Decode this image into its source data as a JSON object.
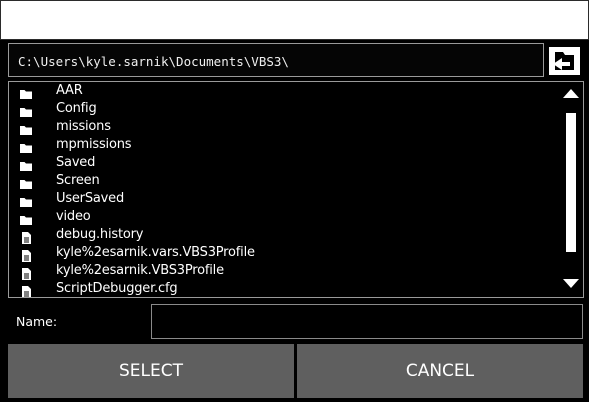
{
  "dialog": {
    "title": "",
    "path": "C:\\Users\\kyle.sarnik\\Documents\\VBS3\\",
    "up_button_icon": "folder-up-arrow-icon",
    "files": [
      {
        "name": "AAR",
        "type": "folder"
      },
      {
        "name": "Config",
        "type": "folder"
      },
      {
        "name": "missions",
        "type": "folder"
      },
      {
        "name": "mpmissions",
        "type": "folder"
      },
      {
        "name": "Saved",
        "type": "folder"
      },
      {
        "name": "Screen",
        "type": "folder"
      },
      {
        "name": "UserSaved",
        "type": "folder"
      },
      {
        "name": "video",
        "type": "folder"
      },
      {
        "name": "debug.history",
        "type": "file"
      },
      {
        "name": "kyle%2esarnik.vars.VBS3Profile",
        "type": "file"
      },
      {
        "name": "kyle%2esarnik.VBS3Profile",
        "type": "file"
      },
      {
        "name": "ScriptDebugger.cfg",
        "type": "file"
      }
    ],
    "name_label": "Name:",
    "name_value": "",
    "select_label": "SELECT",
    "cancel_label": "CANCEL"
  },
  "colors": {
    "background": "#000000",
    "button": "#5f5f5f",
    "text": "#ffffff",
    "border": "#9a9a9a"
  }
}
